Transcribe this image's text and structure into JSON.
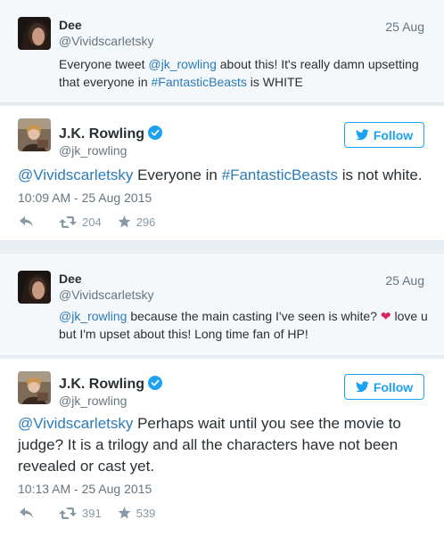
{
  "tweets": [
    {
      "kind": "reply",
      "name": "Dee",
      "handle": "@Vividscarletsky",
      "date": "25 Aug",
      "text": [
        {
          "t": "Everyone tweet "
        },
        {
          "t": "@jk_rowling",
          "link": true
        },
        {
          "t": " about this! It's really damn upsetting that everyone in "
        },
        {
          "t": "#FantasticBeasts",
          "link": true
        },
        {
          "t": " is WHITE"
        }
      ]
    },
    {
      "kind": "main",
      "name": "J.K. Rowling",
      "handle": "@jk_rowling",
      "follow_label": "Follow",
      "text": [
        {
          "t": "@Vividscarletsky",
          "link": true
        },
        {
          "t": " Everyone in "
        },
        {
          "t": "#FantasticBeasts",
          "link": true
        },
        {
          "t": " is not white."
        }
      ],
      "time": "10:09 AM - 25 Aug 2015",
      "retweets": "204",
      "favorites": "296"
    },
    {
      "kind": "reply",
      "name": "Dee",
      "handle": "@Vividscarletsky",
      "date": "25 Aug",
      "text": [
        {
          "t": "@jk_rowling",
          "link": true
        },
        {
          "t": " because the main casting I've seen is white? "
        },
        {
          "t": "❤",
          "heart": true
        },
        {
          "t": " love u but I'm upset about this! Long time fan of HP!"
        }
      ]
    },
    {
      "kind": "main",
      "name": "J.K. Rowling",
      "handle": "@jk_rowling",
      "follow_label": "Follow",
      "text": [
        {
          "t": "@Vividscarletsky",
          "link": true
        },
        {
          "t": " Perhaps wait until you see the movie to judge? It is a trilogy and all the characters have not been revealed or cast yet."
        }
      ],
      "time": "10:13 AM - 25 Aug 2015",
      "retweets": "391",
      "favorites": "539"
    }
  ],
  "colors": {
    "link": "#2b7bb9",
    "follow": "#1da1f2",
    "verified": "#1da1f2",
    "heart": "#e0245e",
    "muted": "#66757f"
  }
}
